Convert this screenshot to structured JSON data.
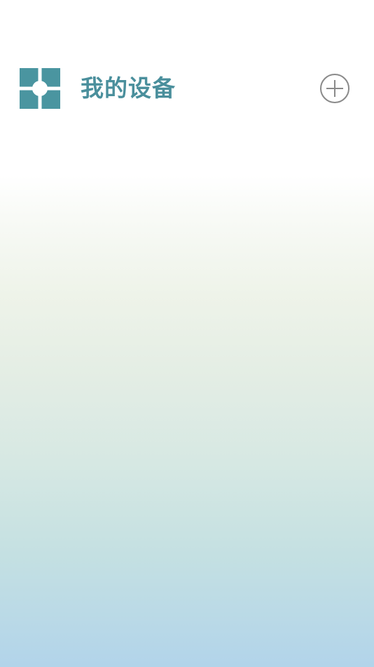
{
  "header": {
    "title": "我的设备",
    "logo_icon": "four-squares-icon",
    "add_icon": "plus-circle-icon"
  },
  "colors": {
    "accent": "#4a8f9c",
    "icon_gray": "#8a8a8a",
    "gradient_top": "#ffffff",
    "gradient_bottom": "#b2d4ea"
  }
}
